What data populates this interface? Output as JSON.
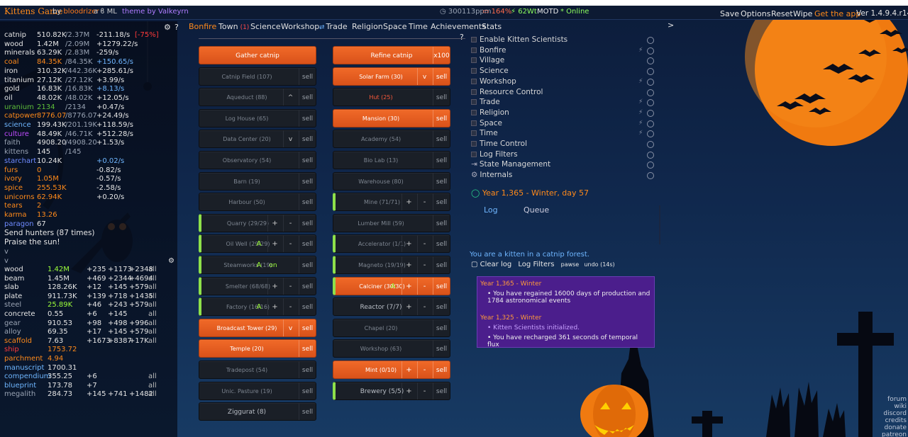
{
  "header": {
    "logo": "Kittens Game",
    "by_text": "by",
    "author": "bloodrizer",
    "suffix": "a ϐ ML",
    "theme_text": "theme by Valkeyrn",
    "stats": "300113ppm",
    "battery": "164%",
    "power": "62Wt",
    "motd": "MOTD",
    "online": "* Online",
    "links": [
      "Save",
      "Options",
      "Reset",
      "Wipe"
    ],
    "get_app": "Get the app",
    "version": "Ver 1.4.9.4.r1413"
  },
  "resources": [
    {
      "name": "catnip",
      "amount": "510.82K",
      "max": "/2.37M",
      "rate": "-211.18/s",
      "extra": "[-75%]",
      "color": "#e6e6e6"
    },
    {
      "name": "wood",
      "amount": "1.42M",
      "max": "/2.09M",
      "rate": "+1279.22/s",
      "color": "#e6e6e6"
    },
    {
      "name": "minerals",
      "amount": "63.29K",
      "max": "/2.83M",
      "rate": "-259/s",
      "color": "#e6e6e6"
    },
    {
      "name": "coal",
      "amount": "84.35K",
      "max": "/84.35K",
      "rate": "+150.65/s",
      "color": "#ff8a1a"
    },
    {
      "name": "iron",
      "amount": "310.32K",
      "max": "/442.36K",
      "rate": "+285.61/s",
      "color": "#e6e6e6"
    },
    {
      "name": "titanium",
      "amount": "27.12K",
      "max": "/27.12K",
      "rate": "+3.99/s",
      "color": "#e6e6e6"
    },
    {
      "name": "gold",
      "amount": "16.83K",
      "max": "/16.83K",
      "rate": "+8.13/s",
      "color": "#e6e6e6"
    },
    {
      "name": "oil",
      "amount": "48.02K",
      "max": "/48.02K",
      "rate": "+12.05/s",
      "color": "#e6e6e6"
    },
    {
      "name": "uranium",
      "amount": "2134",
      "max": "/2134",
      "rate": "+0.47/s",
      "color": "#5fbf3a"
    },
    {
      "name": "catpower",
      "amount": "8776.07",
      "max": "/8776.07",
      "rate": "+24.49/s",
      "color": "#ff8a1a"
    },
    {
      "name": "science",
      "amount": "199.43K",
      "max": "/201.19K",
      "rate": "+118.59/s",
      "color": "#6fb6ff"
    },
    {
      "name": "culture",
      "amount": "48.49K",
      "max": "/46.71K",
      "rate": "+512.28/s",
      "color": "#c04cff"
    },
    {
      "name": "faith",
      "amount": "4908.20",
      "max": "/4908.20",
      "rate": "+1.53/s",
      "color": "#9aa4b4"
    },
    {
      "name": "kittens",
      "amount": "145",
      "max": "/145",
      "rate": "",
      "color": "#9aa4b4"
    },
    {
      "name": "starchart",
      "amount": "10.24K",
      "max": "",
      "rate": "+0.02/s",
      "color": "#6f8bff"
    },
    {
      "name": "furs",
      "amount": "0",
      "max": "",
      "rate": "-0.82/s",
      "color": "#ff8a1a"
    },
    {
      "name": "ivory",
      "amount": "1.05M",
      "max": "",
      "rate": "-0.57/s",
      "color": "#ff8a1a"
    },
    {
      "name": "spice",
      "amount": "255.53K",
      "max": "",
      "rate": "-2.58/s",
      "color": "#ff8a1a"
    },
    {
      "name": "unicorns",
      "amount": "62.94K",
      "max": "",
      "rate": "+0.20/s",
      "color": "#ff8a1a"
    },
    {
      "name": "tears",
      "amount": "2",
      "max": "",
      "rate": "",
      "color": "#ff8a1a"
    },
    {
      "name": "karma",
      "amount": "13.26",
      "max": "",
      "rate": "",
      "color": "#ff8a1a"
    },
    {
      "name": "paragon",
      "amount": "67",
      "max": "",
      "rate": "",
      "color": "#6f8bff"
    }
  ],
  "actions": {
    "hunters": "Send hunters (87 times)",
    "praise": "Praise the sun!",
    "v1": "v",
    "v2": "v",
    "v3": "v"
  },
  "crafts": [
    {
      "name": "wood",
      "amount": "1.42M",
      "a": "+235",
      "b": "+1173",
      "c": "+2348",
      "all": "all",
      "color": "#e6e6e6",
      "acolor": "#9dff3a"
    },
    {
      "name": "beam",
      "amount": "1.45M",
      "a": "+469",
      "b": "+2344",
      "c": "+4694",
      "all": "all",
      "color": "#e6e6e6",
      "acolor": "#e6e6e6"
    },
    {
      "name": "slab",
      "amount": "128.26K",
      "a": "+12",
      "b": "+145",
      "c": "+579",
      "all": "all",
      "color": "#e6e6e6",
      "acolor": "#e6e6e6"
    },
    {
      "name": "plate",
      "amount": "911.73K",
      "a": "+139",
      "b": "+718",
      "c": "+1435",
      "all": "all",
      "color": "#e6e6e6",
      "acolor": "#e6e6e6"
    },
    {
      "name": "steel",
      "amount": "25.89K",
      "a": "+46",
      "b": "+243",
      "c": "+579",
      "all": "all",
      "color": "#9aa4b4",
      "acolor": "#9dff3a"
    },
    {
      "name": "concrete",
      "amount": "0.55",
      "a": "+6",
      "b": "+145",
      "c": "",
      "all": "all",
      "color": "#e6e6e6",
      "acolor": "#e6e6e6"
    },
    {
      "name": "gear",
      "amount": "910.53",
      "a": "+98",
      "b": "+498",
      "c": "+996",
      "all": "all",
      "color": "#9aa4b4",
      "acolor": "#e6e6e6"
    },
    {
      "name": "alloy",
      "amount": "69.35",
      "a": "+17",
      "b": "+145",
      "c": "+579",
      "all": "all",
      "color": "#9aa4b4",
      "acolor": "#e6e6e6"
    },
    {
      "name": "scaffold",
      "amount": "7.63",
      "a": "+1673",
      "b": "+8387",
      "c": "+17K",
      "all": "all",
      "color": "#ff8a1a",
      "acolor": "#e6e6e6"
    },
    {
      "name": "ship",
      "amount": "1753.72",
      "a": "",
      "b": "",
      "c": "",
      "all": "",
      "color": "#ff3a3a",
      "acolor": "#ff8a1a"
    },
    {
      "name": "parchment",
      "amount": "4.94",
      "a": "",
      "b": "",
      "c": "",
      "all": "",
      "color": "#ff8a1a",
      "acolor": "#ff8a1a"
    },
    {
      "name": "manuscript",
      "amount": "1700.31",
      "a": "",
      "b": "",
      "c": "",
      "all": "",
      "color": "#6fb6ff",
      "acolor": "#e6e6e6"
    },
    {
      "name": "compendium",
      "amount": "355.25",
      "a": "+6",
      "b": "",
      "c": "",
      "all": "all",
      "color": "#6fb6ff",
      "acolor": "#e6e6e6"
    },
    {
      "name": "blueprint",
      "amount": "173.78",
      "a": "+7",
      "b": "",
      "c": "",
      "all": "all",
      "color": "#6fb6ff",
      "acolor": "#e6e6e6"
    },
    {
      "name": "megalith",
      "amount": "284.73",
      "a": "+145",
      "b": "+741",
      "c": "+1482",
      "all": "all",
      "color": "#9aa4b4",
      "acolor": "#e6e6e6"
    }
  ],
  "tabs": [
    {
      "label": "Bonfire",
      "active": true
    },
    {
      "label": "Town",
      "badge": "(1)"
    },
    {
      "label": "Science"
    },
    {
      "label": "Workshop"
    },
    {
      "label": "Trade",
      "icon": "⇄"
    },
    {
      "label": "Religion"
    },
    {
      "label": "Space"
    },
    {
      "label": "Time"
    },
    {
      "label": "Achievements"
    },
    {
      "label": "Stats"
    }
  ],
  "tab_controls": {
    "gear": "⚙",
    "help": "?",
    "q2": "?",
    "chev": ">"
  },
  "buttons": {
    "gather": "Gather catnip",
    "refine": "Refine catnip",
    "refine_x": "x100",
    "sell": "sell",
    "plus": "+",
    "minus": "-",
    "v": "v",
    "caret": "^",
    "a": "A",
    "on": "on",
    "left": [
      {
        "label": "Catnip Field (107)"
      },
      {
        "label": "Aqueduct (88)"
      },
      {
        "label": "Log House (65)"
      },
      {
        "label": "Data Center (20)"
      },
      {
        "label": "Observatory (54)"
      },
      {
        "label": "Barn (19)"
      },
      {
        "label": "Harbour (50)"
      },
      {
        "label": "Quarry (29/29)"
      },
      {
        "label": "Oil Well (29/29)"
      },
      {
        "label": "Steamworks (19)"
      },
      {
        "label": "Smelter (68/68)"
      },
      {
        "label": "Factory (16/16)"
      },
      {
        "label": "Broadcast Tower (29)"
      },
      {
        "label": "Temple (20)"
      },
      {
        "label": "Tradepost (54)"
      },
      {
        "label": "Unic. Pasture (19)"
      },
      {
        "label": "Ziggurat (8)"
      }
    ],
    "right": [
      {
        "label": "Solar Farm (30)"
      },
      {
        "label": "Hut (25)"
      },
      {
        "label": "Mansion (30)"
      },
      {
        "label": "Academy (54)"
      },
      {
        "label": "Bio Lab (13)"
      },
      {
        "label": "Warehouse (80)"
      },
      {
        "label": "Mine (71/71)"
      },
      {
        "label": "Lumber Mill (59)"
      },
      {
        "label": "Accelerator (1/1)"
      },
      {
        "label": "Magneto (19/19)"
      },
      {
        "label": "Calciner (30/30)"
      },
      {
        "label": "Reactor (7/7)"
      },
      {
        "label": "Chapel (20)"
      },
      {
        "label": "Workshop (63)"
      },
      {
        "label": "Mint (0/10)"
      },
      {
        "label": "Brewery (5/5)"
      }
    ]
  },
  "kitten_scientists": {
    "items": [
      {
        "label": "Enable Kitten Scientists",
        "bolt": false
      },
      {
        "label": "Bonfire",
        "bolt": true
      },
      {
        "label": "Village",
        "bolt": false
      },
      {
        "label": "Science",
        "bolt": false
      },
      {
        "label": "Workshop",
        "bolt": true
      },
      {
        "label": "Resource Control",
        "bolt": false
      },
      {
        "label": "Trade",
        "bolt": true
      },
      {
        "label": "Religion",
        "bolt": true
      },
      {
        "label": "Space",
        "bolt": true
      },
      {
        "label": "Time",
        "bolt": true
      },
      {
        "label": "Time Control",
        "bolt": false
      },
      {
        "label": "Log Filters",
        "bolt": false
      },
      {
        "label": "State Management",
        "bolt": false,
        "prefix": "⇥"
      },
      {
        "label": "Internals",
        "bolt": false,
        "prefix": "⚙"
      }
    ],
    "calendar": "Year 1,365 - Winter, day 57",
    "tab_log": "Log",
    "tab_queue": "Queue"
  },
  "log": {
    "intro": "You are a kitten in a catnip forest.",
    "clear": "Clear log",
    "filters": "Log Filters",
    "pawse": "pawse",
    "undo": "undo (14s)",
    "entries": [
      {
        "head": "Year 1,365 - Winter",
        "lines": [
          "You have regained 16000 days of production and 1784 astronomical events"
        ]
      },
      {
        "head": "Year 1,325 - Winter",
        "lines": [
          "Kitten Scientists initialized.",
          "You have recharged 361 seconds of temporal flux"
        ]
      }
    ]
  },
  "side_links": [
    "forum",
    "wiki",
    "discord",
    "credits",
    "donate",
    "patreon"
  ],
  "colors": {
    "accent": "#ff8a1a",
    "button_orange": "#e85e22",
    "active_edge": "#8ee04a",
    "log_bg": "#4b1e8c"
  }
}
